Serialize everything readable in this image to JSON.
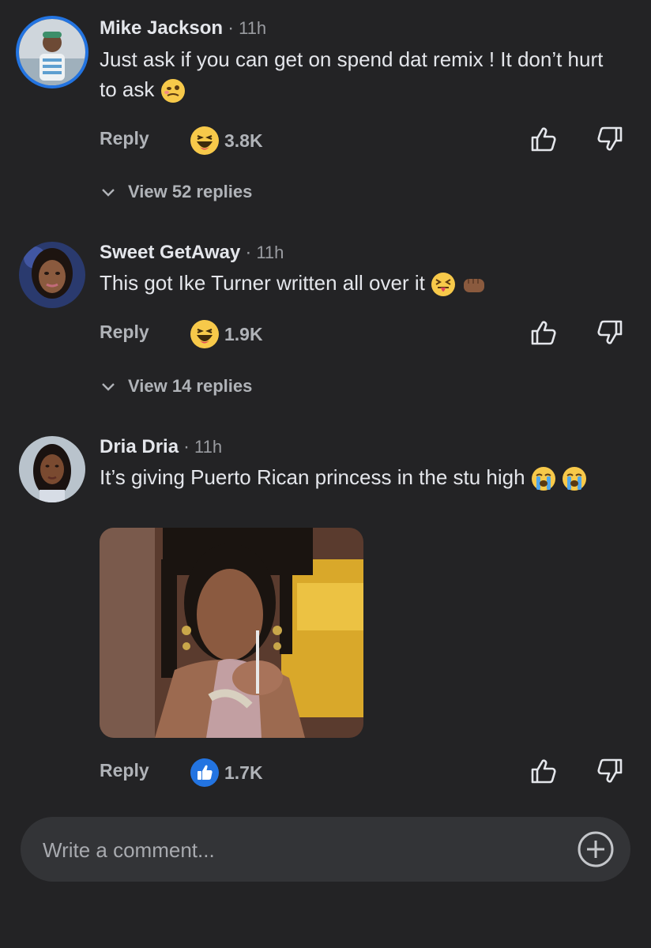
{
  "comments": [
    {
      "author": "Mike Jackson",
      "separator": "·",
      "time": "11h",
      "text": "Just ask if you can get on spend dat remix ! It don’t hurt to ask",
      "emojis": [
        "woozy-face"
      ],
      "reply_label": "Reply",
      "reaction_type": "haha",
      "reaction_count": "3.8K",
      "view_replies": "View 52 replies"
    },
    {
      "author": "Sweet GetAway",
      "separator": "·",
      "time": "11h",
      "text": "This got Ike Turner written all over it",
      "emojis": [
        "squinting-face-with-tongue",
        "oncoming-fist"
      ],
      "reply_label": "Reply",
      "reaction_type": "haha",
      "reaction_count": "1.9K",
      "view_replies": "View 14 replies"
    },
    {
      "author": "Dria Dria",
      "separator": "·",
      "time": "11h",
      "text": "It’s giving Puerto Rican princess in the stu high",
      "emojis": [
        "loudly-crying-face",
        "loudly-crying-face"
      ],
      "attachment": "gif",
      "reply_label": "Reply",
      "reaction_type": "like",
      "reaction_count": "1.7K"
    }
  ],
  "composer": {
    "placeholder": "Write a comment..."
  },
  "colors": {
    "background": "#232325",
    "composer_bg": "#333437",
    "secondary_text": "#b0b3b8",
    "like_blue": "#2374e1",
    "haha_yellow": "#f7c94a"
  }
}
